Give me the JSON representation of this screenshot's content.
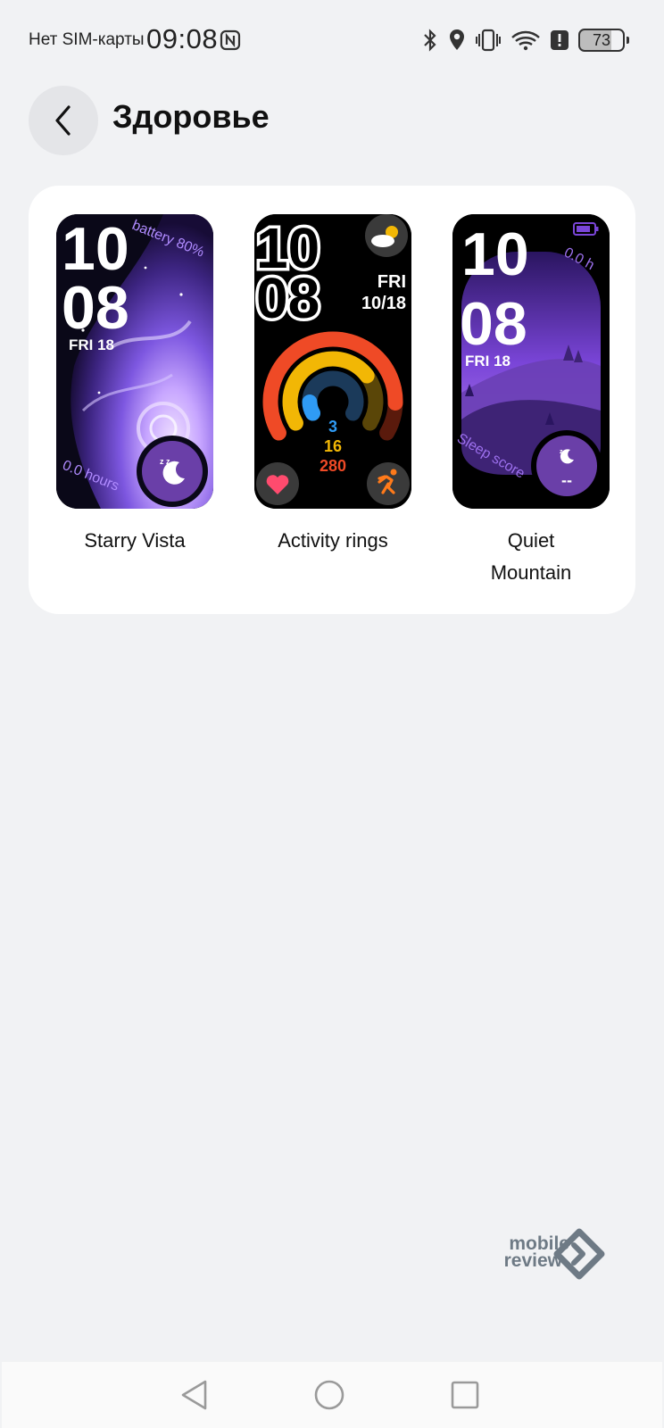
{
  "status_bar": {
    "carrier": "Нет SIM-карты",
    "time": "09:08",
    "battery": "73",
    "icons": [
      "nfc-icon",
      "bluetooth-icon",
      "location-icon",
      "vibrate-icon",
      "wifi-icon",
      "alert-icon",
      "battery-icon"
    ]
  },
  "header": {
    "title": "Здоровье",
    "back_icon": "chevron-left-icon"
  },
  "faces": [
    {
      "name": "Starry Vista",
      "hour": "10",
      "minute": "08",
      "date": "FRI 18",
      "arc_top": "battery 80%",
      "arc_bottom": "0.0 hours",
      "badge_icon": "sleep-moon-icon"
    },
    {
      "name": "Activity rings",
      "hour": "10",
      "minute": "08",
      "day": "FRI",
      "date": "10/18",
      "ring_values": [
        "3",
        "16",
        "280"
      ],
      "ring_colors": [
        "#2f9bf5",
        "#f2b705",
        "#ef4a26"
      ],
      "icons": [
        "weather-icon",
        "heart-icon",
        "running-icon"
      ]
    },
    {
      "name_line1": "Quiet",
      "name_line2": "Mountain",
      "hour": "10",
      "minute": "08",
      "date": "FRI 18",
      "arc_top": "0.0 h",
      "arc_bottom": "Sleep score",
      "badge_value": "--",
      "badge_icon": "sleep-moon-icon"
    }
  ],
  "watermark": {
    "line1": "mobile",
    "line2": "review"
  },
  "nav": {
    "back": "back-triangle-icon",
    "home": "home-circle-icon",
    "recents": "recents-square-icon"
  },
  "colors": {
    "background": "#f1f2f4",
    "card": "#ffffff",
    "accent_purple": "#6a3fa8",
    "activity_red": "#ef4a26",
    "activity_yellow": "#f2b705",
    "activity_blue": "#2f9bf5"
  }
}
